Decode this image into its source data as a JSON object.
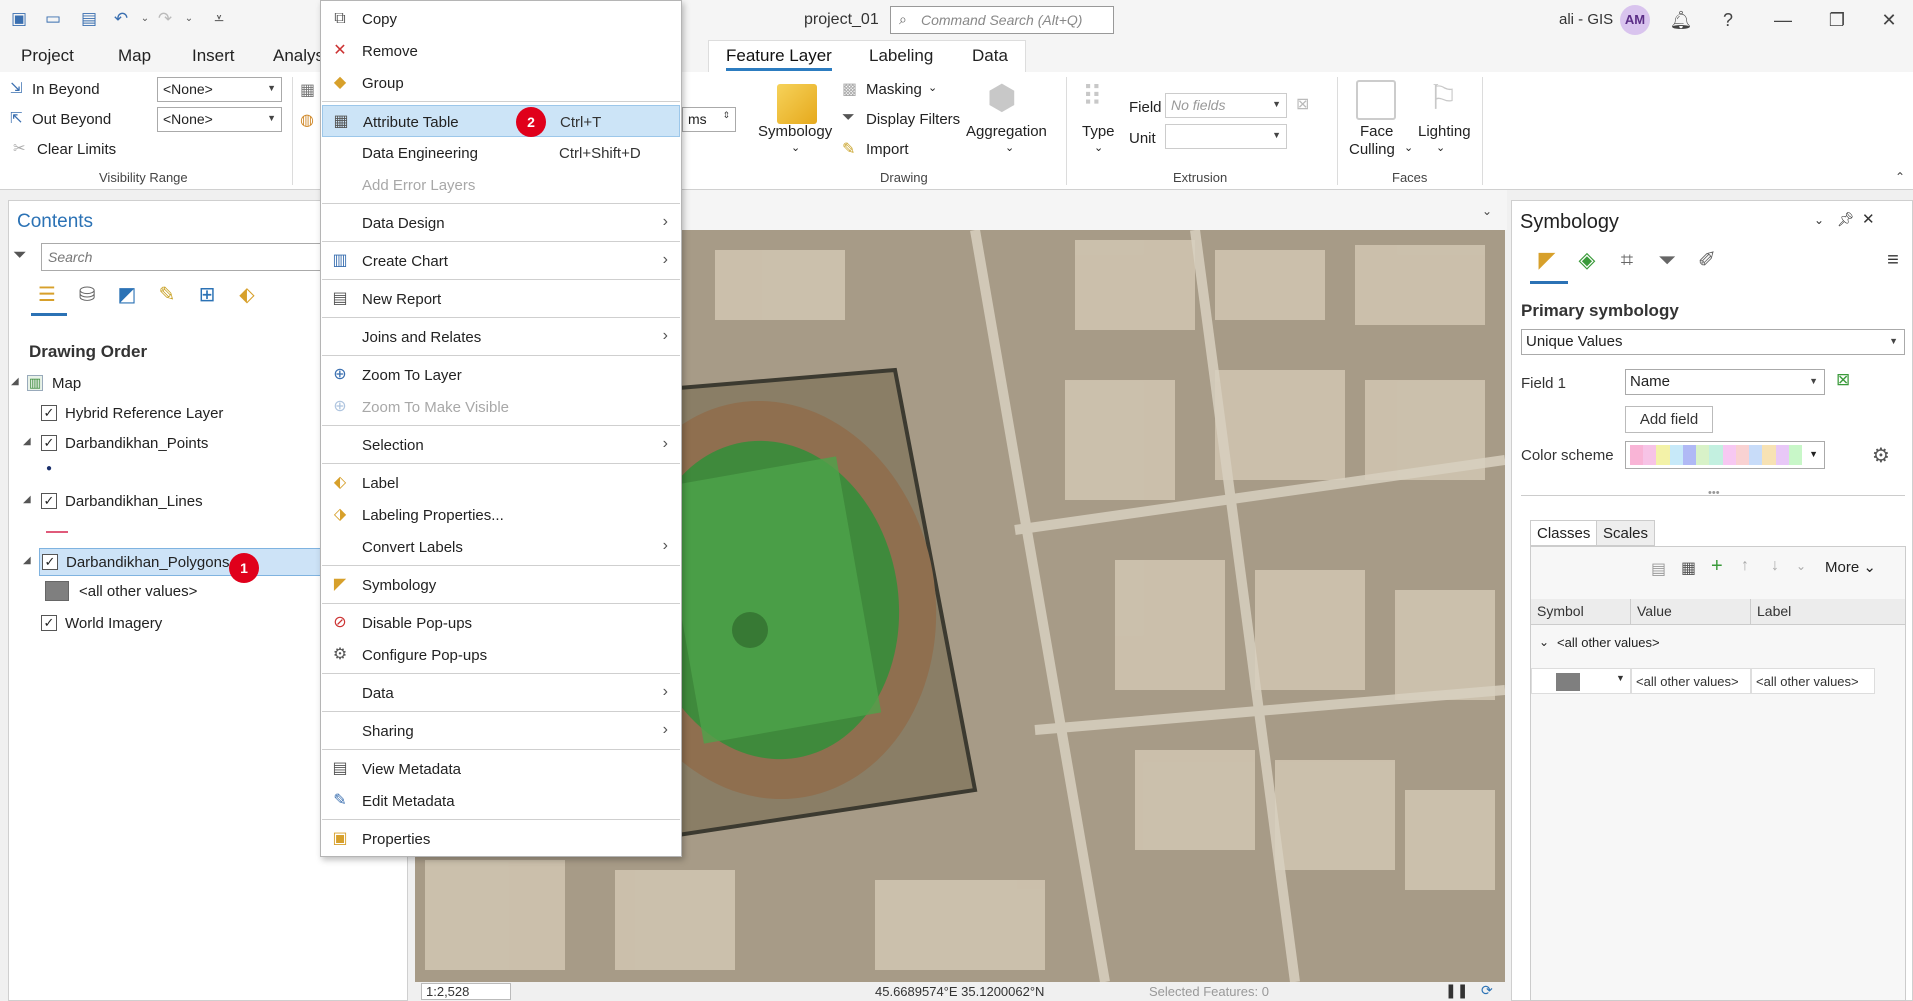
{
  "title_bar": {
    "project_title": "project_01",
    "command_search_placeholder": "Command Search (Alt+Q)",
    "user_name": "ali - GIS",
    "avatar_initials": "AM"
  },
  "tabs": {
    "project": "Project",
    "map": "Map",
    "insert": "Insert",
    "analysis": "Analys",
    "feature_layer": "Feature Layer",
    "labeling": "Labeling",
    "data": "Data"
  },
  "ribbon": {
    "in_beyond": "In Beyond",
    "out_beyond": "Out Beyond",
    "clear_limits": "Clear Limits",
    "in_beyond_value": "<None>",
    "out_beyond_value": "<None>",
    "visibility_range": "Visibility Range",
    "units_value": "ms",
    "symbology": "Symbology",
    "masking": "Masking",
    "display_filters": "Display Filters",
    "import": "Import",
    "aggregation": "Aggregation",
    "drawing": "Drawing",
    "type": "Type",
    "field": "Field",
    "field_value": "No fields",
    "unit": "Unit",
    "extrusion": "Extrusion",
    "face_culling_1": "Face",
    "face_culling_2": "Culling",
    "lighting": "Lighting",
    "faces": "Faces"
  },
  "contents": {
    "title": "Contents",
    "search_placeholder": "Search",
    "drawing_order": "Drawing Order",
    "layers": {
      "map": "Map",
      "hybrid": "Hybrid Reference Layer",
      "points": "Darbandikhan_Points",
      "lines": "Darbandikhan_Lines",
      "polygons": "Darbandikhan_Polygons",
      "other_values": "<all other values>",
      "imagery": "World Imagery"
    }
  },
  "badges": {
    "one": "1",
    "two": "2"
  },
  "context_menu": {
    "copy": "Copy",
    "remove": "Remove",
    "group": "Group",
    "attribute_table": "Attribute Table",
    "attribute_table_shortcut": "Ctrl+T",
    "data_engineering": "Data Engineering",
    "data_engineering_shortcut": "Ctrl+Shift+D",
    "add_error_layers": "Add Error Layers",
    "data_design": "Data Design",
    "create_chart": "Create Chart",
    "new_report": "New Report",
    "joins_relates": "Joins and Relates",
    "zoom_to_layer": "Zoom To Layer",
    "zoom_visible": "Zoom To Make Visible",
    "selection": "Selection",
    "label": "Label",
    "labeling_properties": "Labeling Properties...",
    "convert_labels": "Convert Labels",
    "symbology": "Symbology",
    "disable_popups": "Disable Pop-ups",
    "configure_popups": "Configure Pop-ups",
    "data": "Data",
    "sharing": "Sharing",
    "view_metadata": "View Metadata",
    "edit_metadata": "Edit Metadata",
    "properties": "Properties"
  },
  "symbology": {
    "title": "Symbology",
    "primary": "Primary symbology",
    "method": "Unique Values",
    "field1_label": "Field 1",
    "field1_value": "Name",
    "add_field": "Add field",
    "color_scheme": "Color scheme",
    "tab_classes": "Classes",
    "tab_scales": "Scales",
    "more": "More",
    "col_symbol": "Symbol",
    "col_value": "Value",
    "col_label": "Label",
    "group_heading": "<all other values>",
    "row_value": "<all other values>",
    "row_label": "<all other values>"
  },
  "status": {
    "scale": "1:2,528",
    "coordinates": "45.6689574°E 35.1200062°N",
    "selected": "Selected Features: 0"
  },
  "colors": {
    "accent": "#2b72b5",
    "badge": "#e0001b",
    "menu_highlight": "#cce4f7",
    "symbol_fill": "#7f7f7f"
  }
}
